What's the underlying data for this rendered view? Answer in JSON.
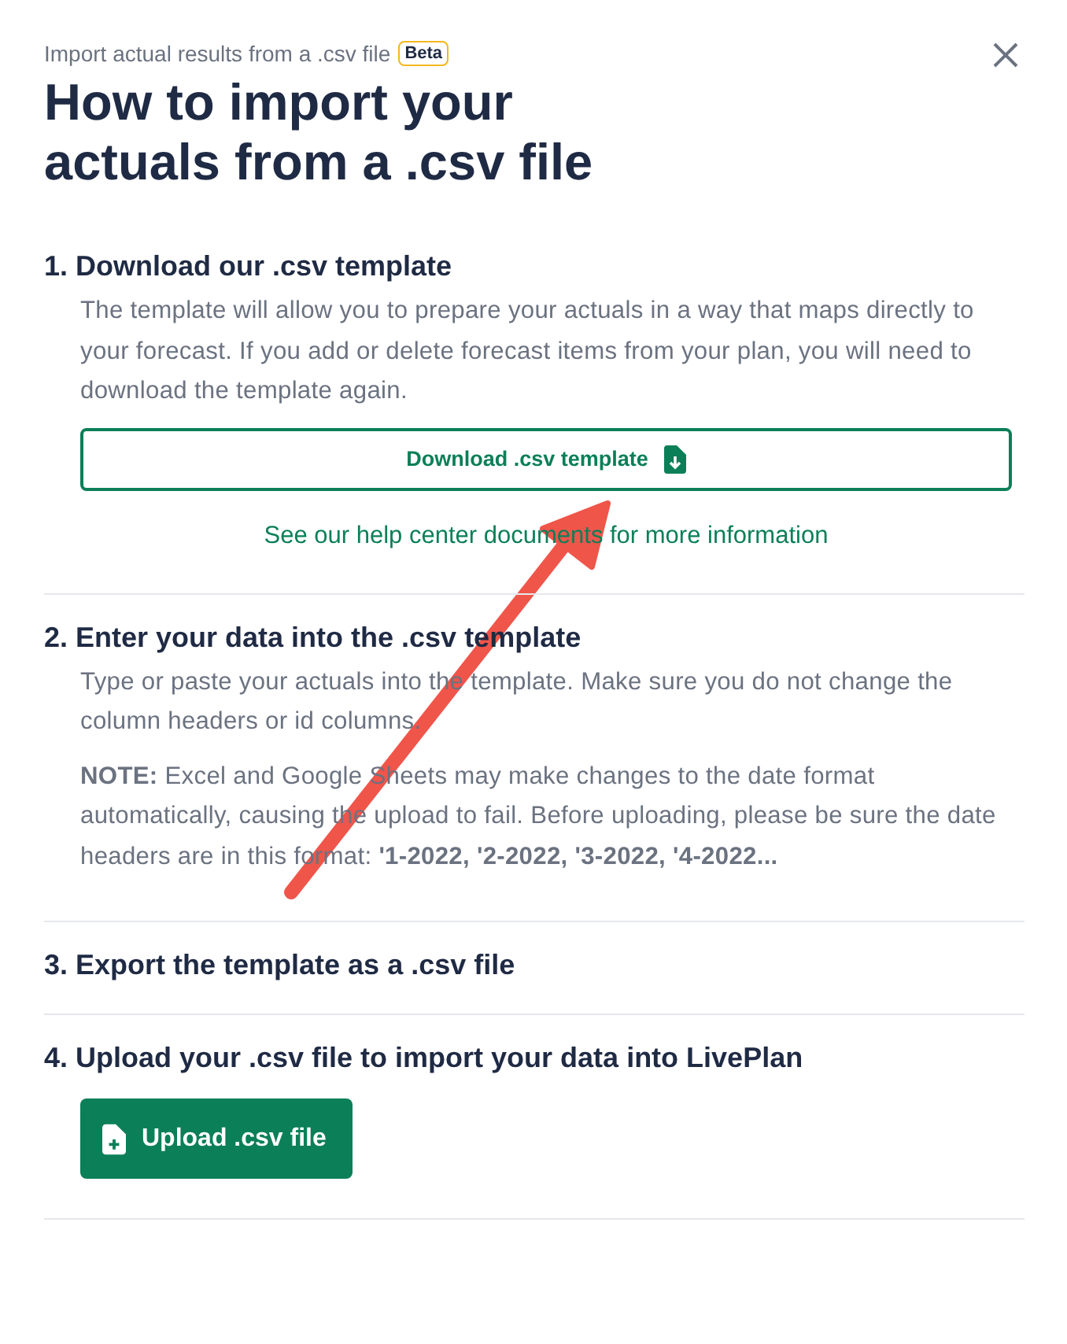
{
  "header": {
    "subtitle": "Import actual results from a .csv file",
    "badge": "Beta",
    "title": "How to import your actuals from a .csv file"
  },
  "sections": [
    {
      "heading": "1. Download our .csv template",
      "paragraphs": [
        "The template will allow you to prepare your actuals in a way that maps directly to your forecast. If you add or delete forecast items from your plan, you will need to download the template again."
      ],
      "button": {
        "label": "Download .csv template",
        "kind": "outline"
      },
      "link": "See our help center documents for more information"
    },
    {
      "heading": "2. Enter your data into the .csv template",
      "paragraphs": [
        "Type or paste your actuals into the template. Make sure you do not change the column headers or id columns.",
        "**NOTE:** Excel and Google Sheets may make changes to the date format automatically, causing the upload to fail. Before uploading, please be sure the date headers are in this format: **'1-2022, '2-2022, '3-2022, '4-2022...**"
      ]
    },
    {
      "heading": "3. Export the template as a .csv file"
    },
    {
      "heading": "4. Upload your .csv file to import your data into LivePlan",
      "button": {
        "label": "Upload .csv file",
        "kind": "solid"
      }
    }
  ]
}
